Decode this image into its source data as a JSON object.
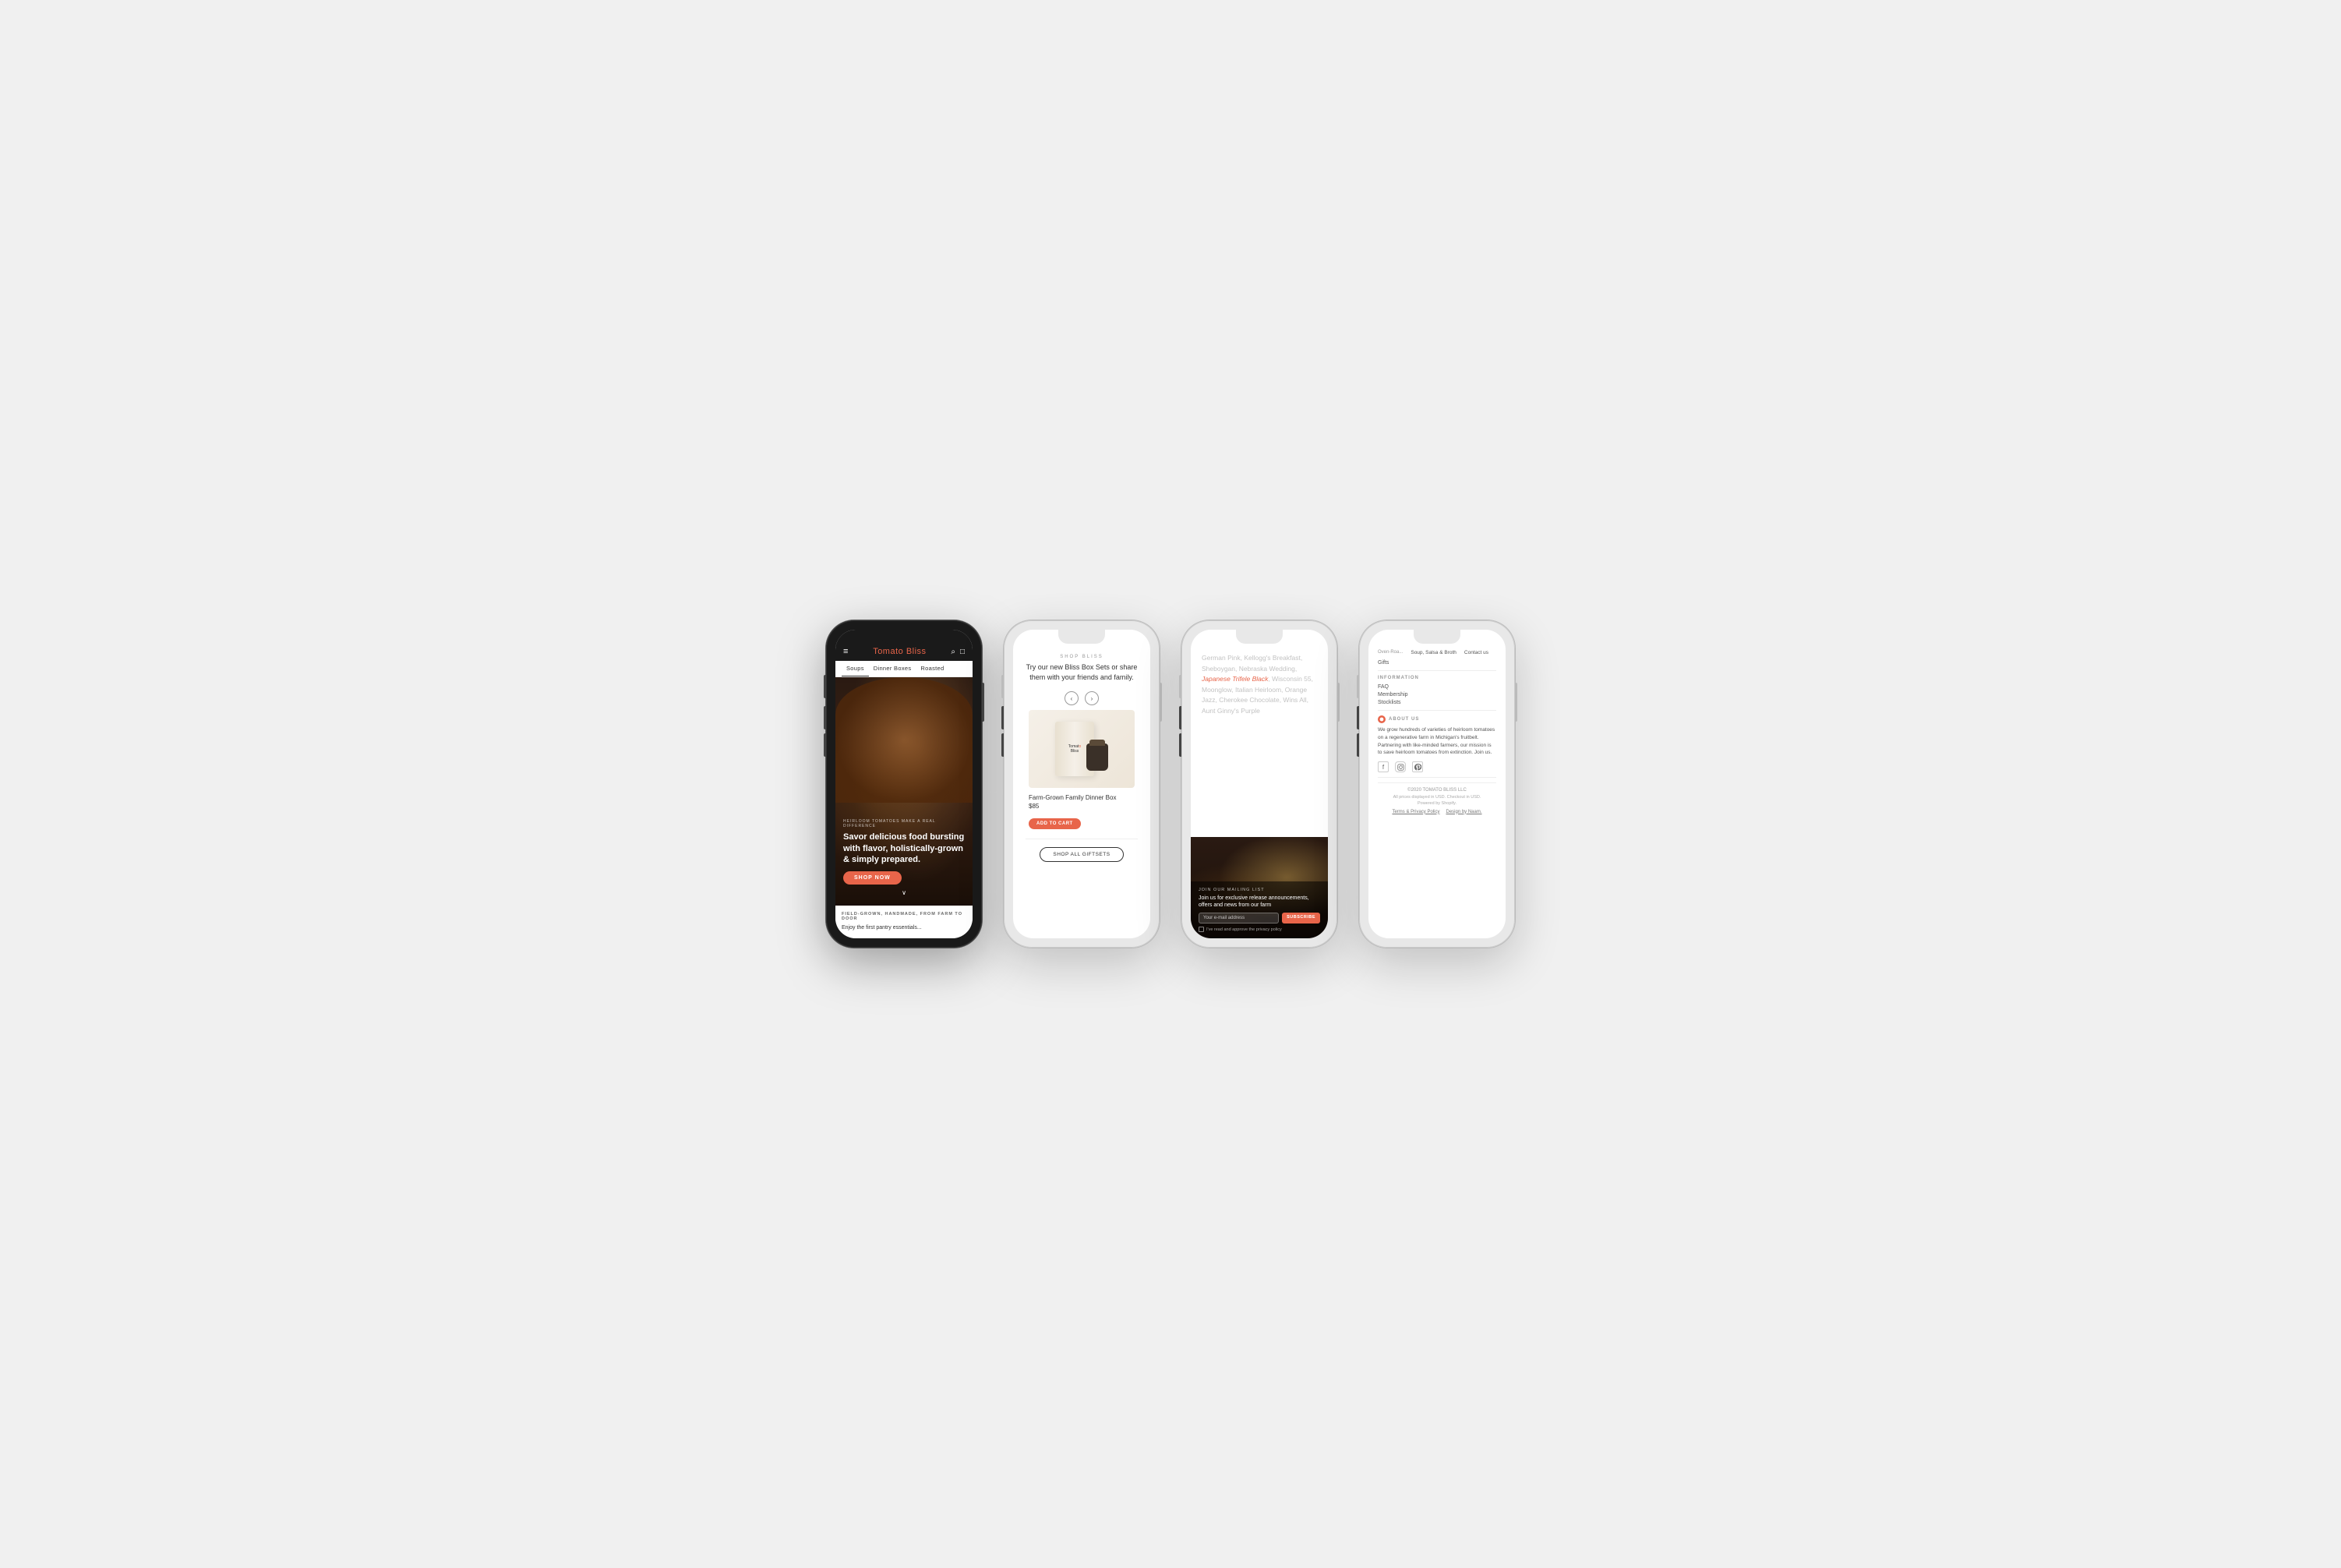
{
  "background": "#f0f0f0",
  "phones": [
    {
      "id": "phone1",
      "theme": "dark",
      "brand": {
        "name_part1": "Tomat",
        "name_part2": "o",
        "name_part3": " Bliss"
      },
      "nav": {
        "items": [
          "Soups",
          "Dinner Boxes",
          "Roasted"
        ]
      },
      "hero": {
        "tag": "HEIRLOOM TOMATOES MAKE A REAL DIFFERENCE",
        "headline": "Savor delicious food bursting\nwith flavor, holistically-grown\n& simply prepared.",
        "shop_button": "SHOP NOW",
        "chevron": "∨"
      },
      "bottom": {
        "tag": "FIELD-GROWN, HANDMADE, FROM FARM TO DOOR",
        "text": "Enjoy the first pantry essentials..."
      }
    },
    {
      "id": "phone2",
      "theme": "light",
      "header": {
        "label": "SHOP BLISS",
        "tagline": "Try our new Bliss Box Sets or share\nthem with your friends and family."
      },
      "product": {
        "name": "Farm-Grown Family Dinner Box",
        "price": "$85",
        "add_button": "ADD TO CART"
      },
      "shop_all_button": "SHOP ALL GIFTSETS"
    },
    {
      "id": "phone3",
      "theme": "light",
      "varieties": "German Pink, Kellogg's Breakfast, Sheboygan, Nebraska Wedding, Japanese Trifele Black, Wisconsin 55, Moonglow, Italian Heirloom, Orange Jazz, Cherokee Chocolate, Wins All, Aunt Ginny's Purple",
      "highlight": "Japanese Trifele Black",
      "mailing": {
        "title": "JOIN OUR MAILING LIST",
        "text": "Join us for exclusive release announcements, offers and news from our farm",
        "email_placeholder": "Your e-mail address",
        "subscribe_button": "SUBSCRIBE",
        "checkbox_label": "I've read and approve the privacy policy"
      }
    },
    {
      "id": "phone4",
      "theme": "light",
      "nav_links": [
        {
          "label": "Oven-Roa...",
          "muted": true
        },
        {
          "label": "Soup, Salsa & Broth"
        },
        {
          "label": "Contact us"
        }
      ],
      "extra_link": "Gifts",
      "information": {
        "title": "INFORMATION",
        "links": [
          "FAQ",
          "Membership",
          "Stocklists"
        ]
      },
      "about": {
        "title": "ABOUT US",
        "text": "We grow hundreds of varieties of heirloom tomatoes on a regenerative farm in Michigan's fruitbelt. Partnering with like-minded farmers, our mission is to save heirloom tomatoes from extinction. Join us.",
        "social": [
          "f",
          "in",
          "p"
        ]
      },
      "footer": {
        "copyright": "©2020 TOMATO BLISS LLC",
        "line1": "All prices displayed in USD. Checkout in USD.",
        "line2": "Powered by Shopify.",
        "links": [
          "Terms & Privacy Policy",
          "Design by Naam."
        ]
      }
    }
  ]
}
